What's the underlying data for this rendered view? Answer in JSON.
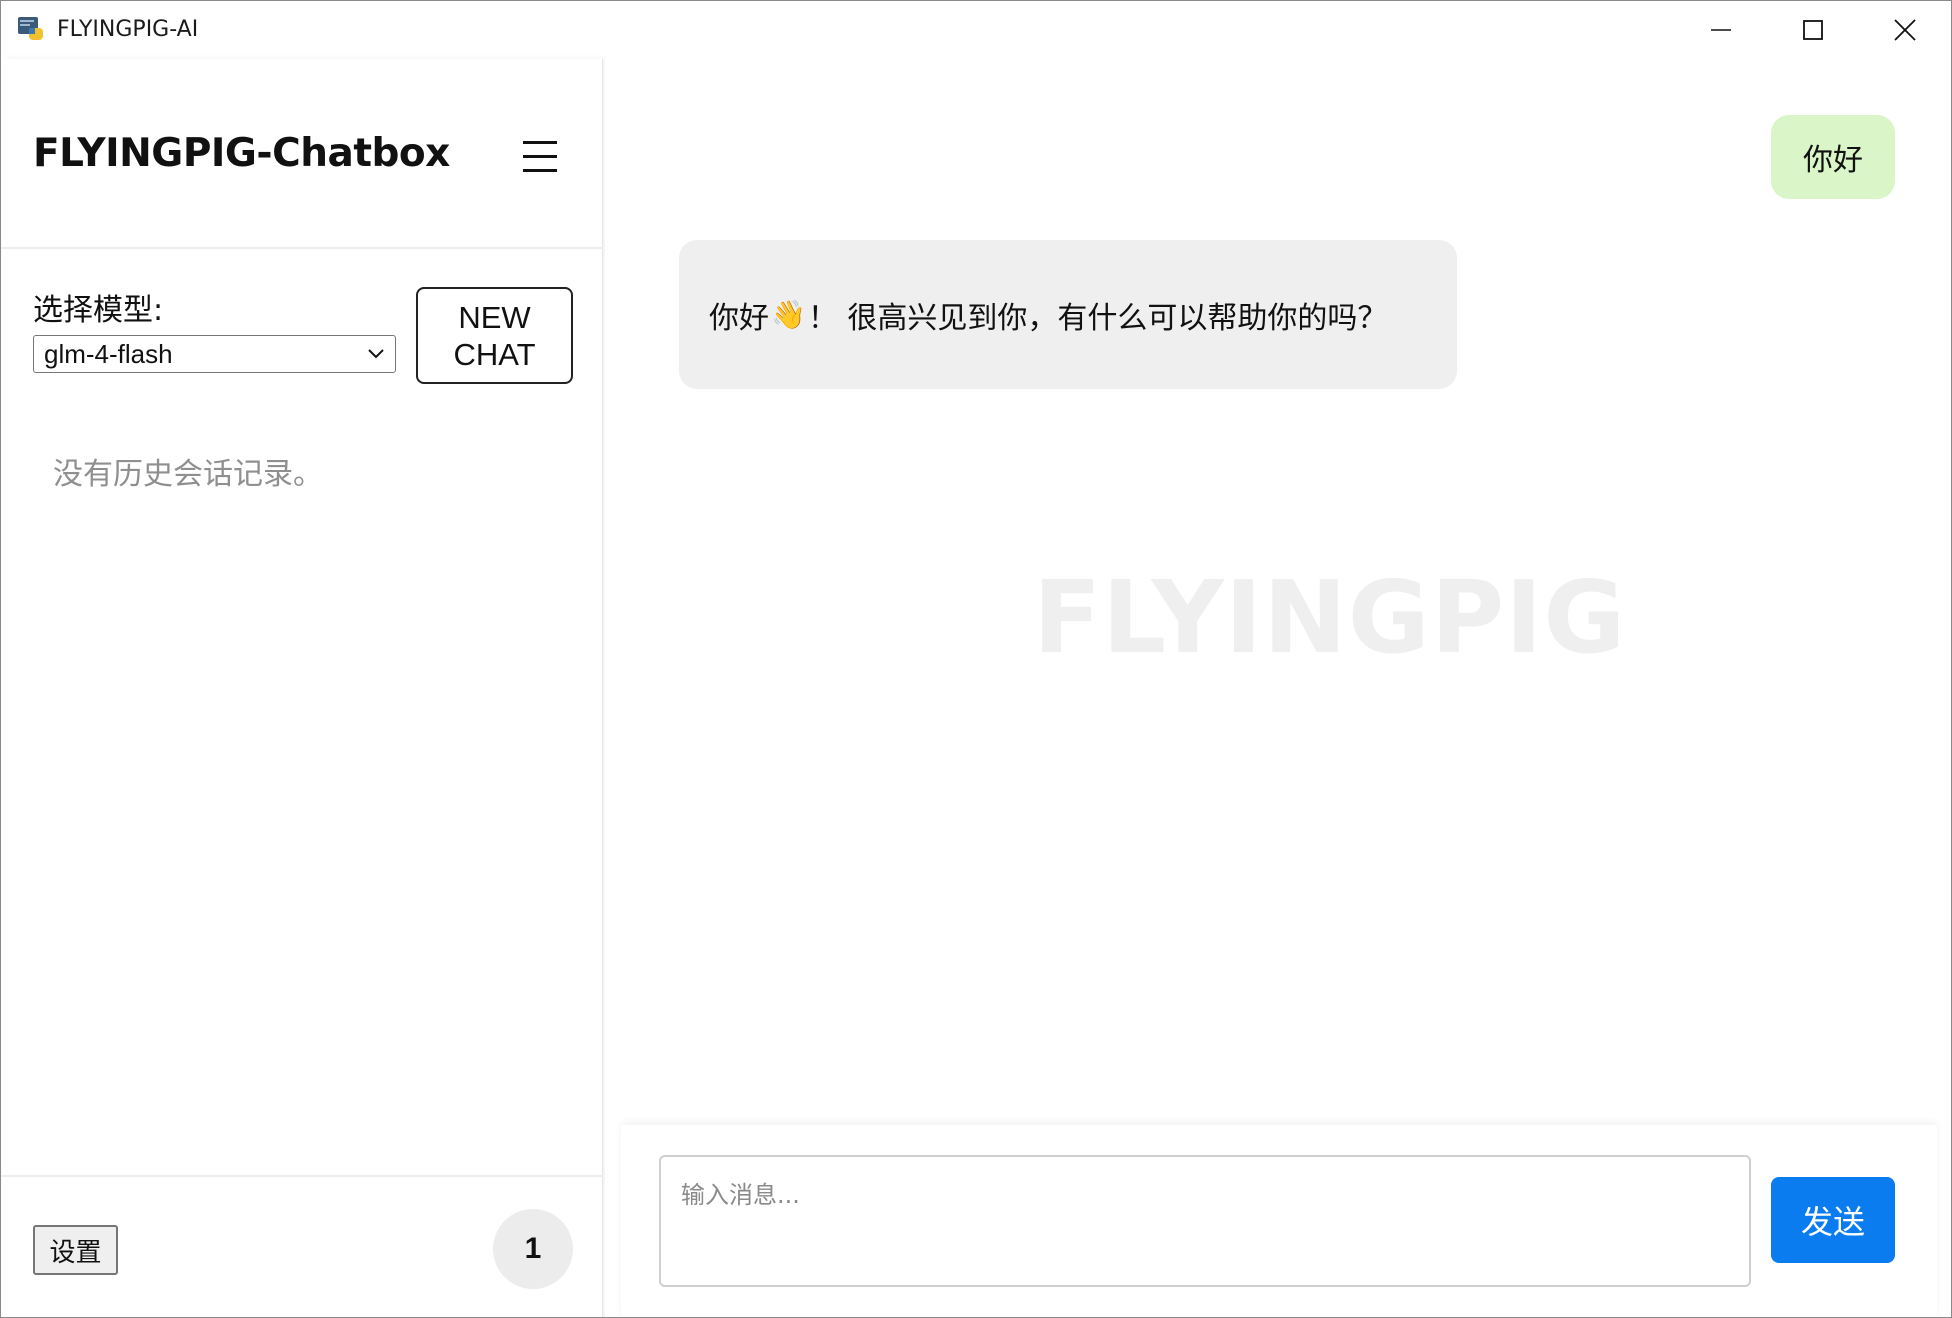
{
  "window": {
    "title": "FLYINGPIG-AI",
    "icon": "python-icon"
  },
  "sidebar": {
    "brand_title": "FLYINGPIG-Chatbox",
    "menu_icon": "hamburger-menu-icon",
    "model_label": "选择模型:",
    "model_selected": "glm-4-flash",
    "new_chat_label_line1": "NEW",
    "new_chat_label_line2": "CHAT",
    "no_history_text": "没有历史会话记录。",
    "settings_label": "设置",
    "badge_count": "1"
  },
  "chat": {
    "watermark": "FLYINGPIG",
    "messages": [
      {
        "role": "user",
        "text": "你好"
      },
      {
        "role": "assistant",
        "text_before": "你好",
        "emoji": "👋",
        "text_after": "！ 很高兴见到你，有什么可以帮助你的吗？"
      }
    ],
    "input_placeholder": "输入消息...",
    "send_label": "发送"
  },
  "colors": {
    "user_bubble": "#daf5c7",
    "assistant_bubble": "#efefef",
    "send_button": "#0a7cf0"
  }
}
